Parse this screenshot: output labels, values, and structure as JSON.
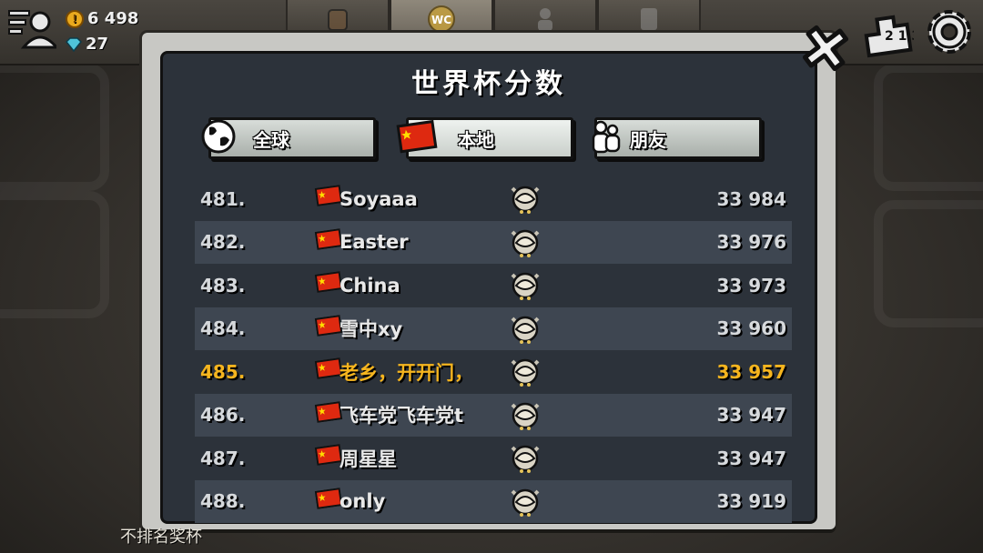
{
  "resources": {
    "coins": "6 498",
    "gems": "27"
  },
  "top_tabs": [
    {
      "icon": "backpack-icon"
    },
    {
      "icon": "world-cup-icon",
      "label": "WC"
    },
    {
      "icon": "team-icon"
    },
    {
      "icon": "chess-icon"
    }
  ],
  "panel": {
    "title": "世界杯分数",
    "tabs": [
      {
        "label": "全球",
        "icon": "globe-icon"
      },
      {
        "label": "本地",
        "icon": "china-flag-icon"
      },
      {
        "label": "朋友",
        "icon": "friends-icon"
      }
    ]
  },
  "leaderboard": [
    {
      "rank": "481.",
      "name": "Soyaaa",
      "score": "33 984"
    },
    {
      "rank": "482.",
      "name": "Easter",
      "score": "33 976"
    },
    {
      "rank": "483.",
      "name": "China",
      "score": "33 973"
    },
    {
      "rank": "484.",
      "name": "雪中xy",
      "score": "33 960"
    },
    {
      "rank": "485.",
      "name": "老乡，开开门，",
      "score": "33 957",
      "highlight": true
    },
    {
      "rank": "486.",
      "name": "飞车党飞车党t",
      "score": "33 947"
    },
    {
      "rank": "487.",
      "name": "周星星",
      "score": "33 947"
    },
    {
      "rank": "488.",
      "name": "only",
      "score": "33 919"
    }
  ],
  "footer": "不排名奖杯",
  "colors": {
    "highlight": "#f6b51e",
    "panel_bg": "#2c323a",
    "row_alt": "#3e4651",
    "flag_red": "#de2910",
    "flag_star": "#ffde00"
  }
}
